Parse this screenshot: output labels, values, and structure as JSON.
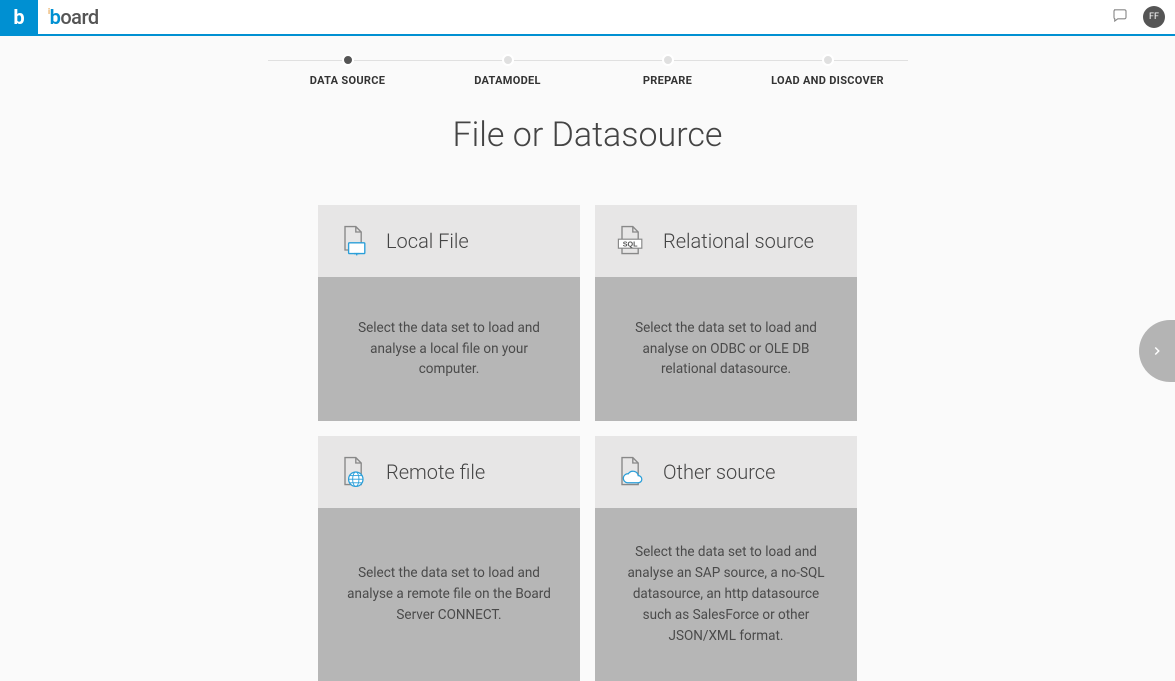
{
  "header": {
    "avatar_initials": "FF"
  },
  "stepper": {
    "steps": [
      {
        "label": "DATA SOURCE",
        "active": true
      },
      {
        "label": "DATAMODEL",
        "active": false
      },
      {
        "label": "PREPARE",
        "active": false
      },
      {
        "label": "LOAD AND DISCOVER",
        "active": false
      }
    ]
  },
  "page": {
    "title": "File or Datasource"
  },
  "cards": [
    {
      "title": "Local File",
      "desc": "Select the data set to load and analyse a local file on your computer.",
      "icon": "file-monitor-icon"
    },
    {
      "title": "Relational source",
      "desc": "Select the data set to load and analyse on ODBC or OLE DB relational datasource.",
      "icon": "file-sql-icon"
    },
    {
      "title": "Remote file",
      "desc": "Select the data set to load and analyse a remote file on the Board Server CONNECT.",
      "icon": "file-globe-icon"
    },
    {
      "title": "Other source",
      "desc": "Select the data set to load and analyse an SAP source, a no-SQL datasource, an http datasource such as SalesForce or other JSON/XML format.",
      "icon": "file-cloud-icon"
    }
  ]
}
